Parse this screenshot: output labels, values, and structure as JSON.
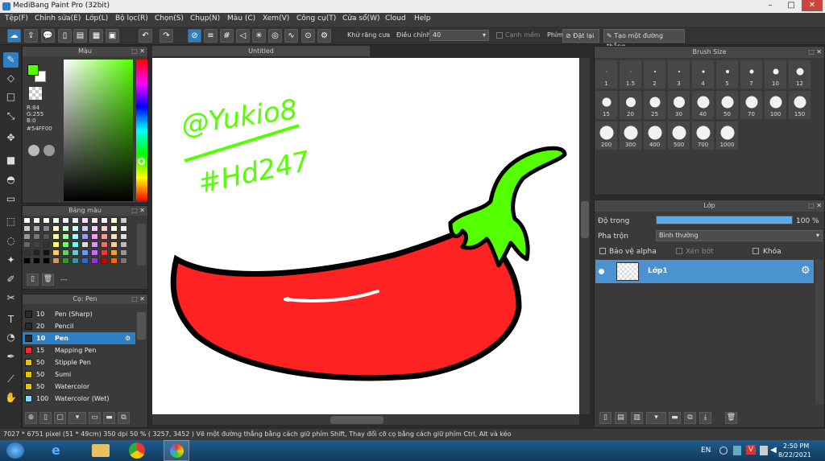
{
  "window": {
    "title": "MediBang Paint Pro (32bit)",
    "min": "–",
    "max": "□",
    "close": "✕"
  },
  "menu": [
    "Tệp(F)",
    "Chỉnh sửa(E)",
    "Lớp(L)",
    "Bộ lọc(R)",
    "Chọn(S)",
    "Chụp(N)",
    "Màu (C)",
    "Xem(V)",
    "Công cụ(T)",
    "Cửa sổ(W)",
    "Cloud",
    "Help"
  ],
  "toolbar": {
    "antialias_label": "Khử răng cưa",
    "correction_label": "Điều chỉnh",
    "correction_value": "40",
    "soft_edge_label": "Cạnh mềm",
    "key_label": "Phím",
    "reset_label": "Đặt lại",
    "straight_line_label": "Tạo một đường thẳng"
  },
  "color_panel": {
    "title": "Màu",
    "r": "R:84",
    "g": "G:255",
    "b": "B:0",
    "hex": "#54FF00",
    "fg": "#54ff00"
  },
  "palette_panel": {
    "title": "Bảng màu",
    "status": "---"
  },
  "brush_panel": {
    "title": "Cọ: Pen",
    "brushes": [
      {
        "size": "10",
        "name": "Pen (Sharp)",
        "color": "#2a2a2a"
      },
      {
        "size": "20",
        "name": "Pencil",
        "color": "#2a2a2a"
      },
      {
        "size": "10",
        "name": "Pen",
        "color": "#2a2a2a"
      },
      {
        "size": "15",
        "name": "Mapping Pen",
        "color": "#e03030"
      },
      {
        "size": "50",
        "name": "Stipple Pen",
        "color": "#e8c400"
      },
      {
        "size": "50",
        "name": "Sumi",
        "color": "#e8c400"
      },
      {
        "size": "50",
        "name": "Watercolor",
        "color": "#e8c400"
      },
      {
        "size": "100",
        "name": "Watercolor (Wet)",
        "color": "#8ad8ff"
      }
    ]
  },
  "document": {
    "tab": "Untitled",
    "text_line1": "@Yukio8",
    "text_line2": "#Hd247"
  },
  "brush_size_panel": {
    "title": "Brush Size",
    "sizes": [
      "1",
      "1.5",
      "2",
      "3",
      "4",
      "5",
      "7",
      "10",
      "12",
      "15",
      "20",
      "25",
      "30",
      "40",
      "50",
      "70",
      "100",
      "150",
      "200",
      "300",
      "400",
      "500",
      "700",
      "1000"
    ]
  },
  "layer_panel": {
    "title": "Lớp",
    "opacity_label": "Độ trong",
    "opacity_value": "100 %",
    "opacity": 1.0,
    "blend_label": "Pha trộn",
    "blend_value": "Bình thường",
    "protect_alpha": "Bảo vệ alpha",
    "clipping": "Xén bớt",
    "lock": "Khóa",
    "layer_name": "Lớp1"
  },
  "status": {
    "text": "7027 * 6751 pixel   (51 * 49cm)   350 dpi   50 %   ( 3257, 3452 )   Vẽ một đường thẳng bằng cách giữ phím Shift, Thay đổi cỡ cọ bằng cách giữ phím Ctrl, Alt và kéo"
  },
  "taskbar": {
    "lang": "EN",
    "time": "2:50 PM",
    "date": "8/22/2021"
  }
}
